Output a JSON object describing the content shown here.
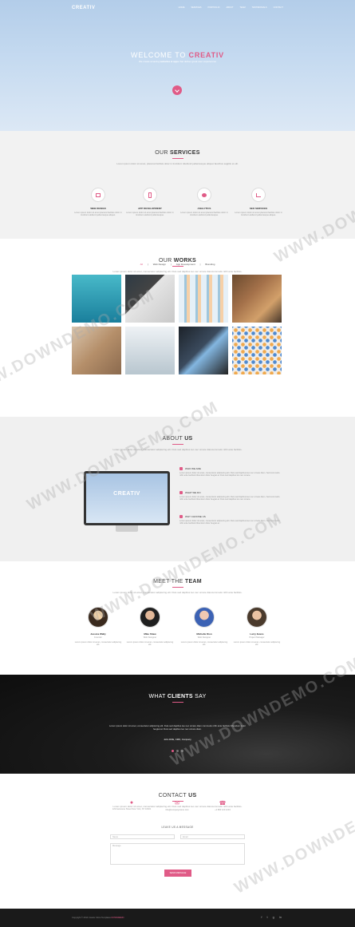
{
  "hero": {
    "logo": "CREATIV",
    "menu": [
      "HOME",
      "SERVICES",
      "PORTFOLIO",
      "ABOUT",
      "TEAM",
      "TESTIMONIALS",
      "CONTACT"
    ],
    "welcome_prefix": "WELCOME TO",
    "welcome_brand": "CREATIV",
    "tagline_1": "We create amazing",
    "tagline_bold": "websites & apps",
    "tagline_2": "that deliver great user experiences"
  },
  "services": {
    "title_light": "OUR",
    "title_bold": "SERVICES",
    "subtitle": "Lorem ipsum dolor sit amet, placerat facilisis dolor in tincidunt. Eleifend pellentesque aliquet faucibus sagittis et elit.",
    "items": [
      {
        "icon": "monitor-icon",
        "title": "WEB DESIGN",
        "text": "Lorem ipsum dolor sit amet placerat facilisis dolor in tincidunt eleifend pellentesque aliquet."
      },
      {
        "icon": "mobile-icon",
        "title": "APP DEVELOPMENT",
        "text": "Lorem ipsum dolor sit amet placerat facilisis dolor in tincidunt eleifend pellentesque."
      },
      {
        "icon": "pie-chart-icon",
        "title": "ANALYTICS",
        "text": "Lorem ipsum dolor sit amet placerat facilisis dolor in tincidunt eleifend pellentesque."
      },
      {
        "icon": "line-chart-icon",
        "title": "SEO SERVICES",
        "text": "Lorem ipsum dolor sit amet placerat facilisis dolor in tincidunt eleifend pellentesque aliquet."
      }
    ]
  },
  "works": {
    "title_light": "OUR",
    "title_bold": "WORKS",
    "subtitle": "Lorem ipsum dolor sit amet, consectetur adipiscing elit. Duis sed dapibus leo nec ornare diamcommodo nibh ante facilisis.",
    "filters": [
      "All",
      "Web Design",
      "App Development",
      "Branding"
    ],
    "active_filter": "All"
  },
  "about": {
    "title_light": "ABOUT",
    "title_bold": "US",
    "subtitle": "Lorem ipsum dolor sit amet, consectetur adipiscing elit. Duis sed dapibus leo nec ornare diamcommodo nibh ante facilisis.",
    "screen_text": "CREATIV",
    "features": [
      {
        "title": "WHO WE ARE",
        "text": "Lorem ipsum dolor sit amet, consectetur adipiscing elit. Duis sed dapibus leo nec ornare diam. Sed commodo nibh ante facilisis bibendum dolor feugiat at. Duis sed dapibus leo nec ornare."
      },
      {
        "title": "WHAT WE DO",
        "text": "Lorem ipsum dolor sit amet, consectetur adipiscing elit. Duis sed dapibus leo nec ornare diam. Sed commodo nibh ante facilisis bibendum dolor feugiat at. Duis sed dapibus leo nec ornare."
      },
      {
        "title": "WHY CHOOSE US",
        "text": "Lorem ipsum dolor sit amet, consectetur adipiscing elit. Duis sed dapibus leo nec ornare diam. Sed commodo nibh ante facilisis bibendum dolor feugiat at."
      }
    ]
  },
  "team": {
    "title_light": "MEET THE",
    "title_bold": "TEAM",
    "subtitle": "Lorem ipsum dolor sit amet, consectetur adipiscing elit. Duis sed dapibus leo nec ornare diamcommodo nibh ante facilisis.",
    "members": [
      {
        "name": "Jessica Wally",
        "role": "Founder",
        "text": "Lorem ipsum dolor sit amet, consectetur adipiscing elit."
      },
      {
        "name": "Mike Shaw",
        "role": "Web Designer",
        "text": "Lorem ipsum dolor sit amet, consectetur adipiscing elit."
      },
      {
        "name": "Michelle Dion",
        "role": "Web Designer",
        "text": "Lorem ipsum dolor sit amet, consectetur adipiscing elit."
      },
      {
        "name": "Larry Evans",
        "role": "Project Manager",
        "text": "Lorem ipsum dolor sit amet, consectetur adipiscing elit."
      }
    ]
  },
  "clients": {
    "title_light": "WHAT",
    "title_bold": "CLIENTS",
    "title_end": "SAY",
    "quote": "Lorem ipsum dolor sit amet, consectetur adipiscing elit. Duis sed dapibus leo nec ornare diam commodo nibh ante facilisis bibendum dolor feugiat at. Duis sed dapibus leo nec ornare diam.",
    "author": "John DOE, CMO, Company"
  },
  "contact": {
    "title_light": "CONTACT",
    "title_bold": "US",
    "subtitle": "Lorem ipsum dolor sit amet, consectetur adipiscing elit. Duis sed dapibus leo nec ornare diamcommodo nibh ante facilisis.",
    "address": "123 Awesome Street New York, NY 10021",
    "email": "info@companyname.com",
    "phone": "+1 800 123 1234",
    "leave_message": "LEAVE US A MESSAGE",
    "name_placeholder": "Name",
    "email_placeholder": "Email",
    "message_placeholder": "Message",
    "send_label": "SEND MESSAGE"
  },
  "footer": {
    "copyright": "Copyright © 2014 Creativ. More Templates",
    "copyright_link": "DOWNDEMO",
    "social": [
      "f",
      "t",
      "g",
      "in"
    ]
  },
  "watermark": "WWW.DOWNDEMO.COM",
  "colors": {
    "accent": "#e05b87",
    "dark": "#1a1a1a",
    "light_bg": "#f2f2f2"
  }
}
